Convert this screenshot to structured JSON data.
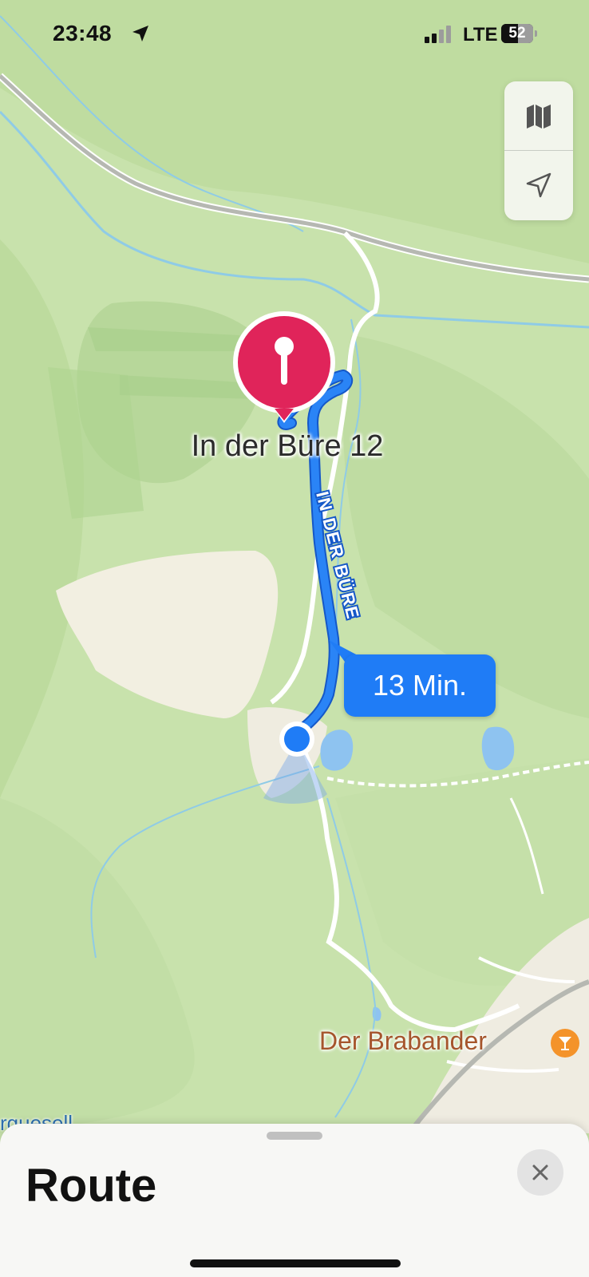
{
  "status_bar": {
    "time": "23:48",
    "network": "LTE",
    "battery_level": "52"
  },
  "map": {
    "destination_label": "In der Büre 12",
    "street_name": "IN DER BÜRE",
    "route_time": "13 Min.",
    "poi_label": "Der Brabander",
    "poi_icon": "cocktail-icon",
    "edge_label": "rguesell",
    "route_color": "#1f7cf6",
    "pin_color": "#e0245a"
  },
  "map_controls": {
    "map_mode_icon": "map-icon",
    "location_icon": "location-arrow-icon"
  },
  "sheet": {
    "title": "Route",
    "close_icon": "close-icon"
  }
}
